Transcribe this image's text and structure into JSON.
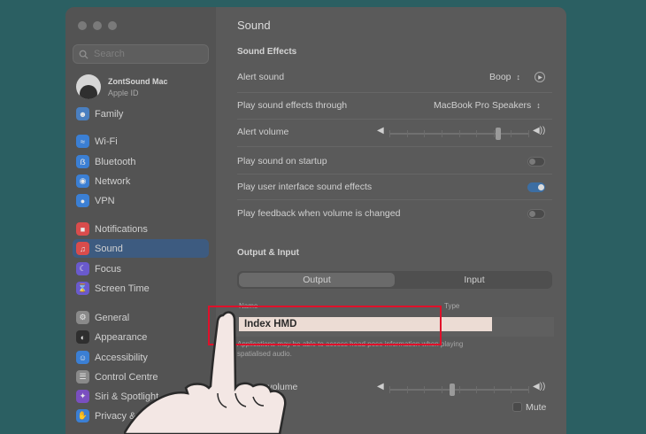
{
  "sidebar": {
    "search_placeholder": "Search",
    "account": {
      "name": "ZontSound Mac",
      "subtitle": "Apple ID"
    },
    "items": [
      {
        "label": "Family",
        "icon": "family-icon",
        "color": "#4a7fc0"
      },
      {
        "label": "Wi-Fi",
        "icon": "wifi-icon",
        "color": "#3b7fd4"
      },
      {
        "label": "Bluetooth",
        "icon": "bluetooth-icon",
        "color": "#3b7fd4"
      },
      {
        "label": "Network",
        "icon": "network-icon",
        "color": "#3b7fd4"
      },
      {
        "label": "VPN",
        "icon": "vpn-icon",
        "color": "#3b7fd4"
      },
      {
        "label": "Notifications",
        "icon": "notifications-icon",
        "color": "#d94c4c"
      },
      {
        "label": "Sound",
        "icon": "sound-icon",
        "color": "#d94c4c"
      },
      {
        "label": "Focus",
        "icon": "focus-icon",
        "color": "#6a5acd"
      },
      {
        "label": "Screen Time",
        "icon": "screen-time-icon",
        "color": "#6a5acd"
      },
      {
        "label": "General",
        "icon": "general-icon",
        "color": "#8a8a8a"
      },
      {
        "label": "Appearance",
        "icon": "appearance-icon",
        "color": "#2f2f2f"
      },
      {
        "label": "Accessibility",
        "icon": "accessibility-icon",
        "color": "#3b7fd4"
      },
      {
        "label": "Control Centre",
        "icon": "control-centre-icon",
        "color": "#8a8a8a"
      },
      {
        "label": "Siri & Spotlight",
        "icon": "siri-icon",
        "color": "#7a4fc0"
      },
      {
        "label": "Privacy & Se",
        "icon": "privacy-icon",
        "color": "#3b7fd4"
      }
    ]
  },
  "content": {
    "title": "Sound",
    "sound_effects": {
      "header": "Sound Effects",
      "alert_sound": {
        "label": "Alert sound",
        "value": "Boop"
      },
      "play_through": {
        "label": "Play sound effects through",
        "value": "MacBook Pro Speakers"
      },
      "alert_volume": {
        "label": "Alert volume",
        "level": 0.78
      },
      "startup": {
        "label": "Play sound on startup",
        "on": false
      },
      "ui_effects": {
        "label": "Play user interface sound effects",
        "on": true
      },
      "feedback": {
        "label": "Play feedback when volume is changed",
        "on": false
      }
    },
    "output_input": {
      "header": "Output & Input",
      "tabs": [
        "Output",
        "Input"
      ],
      "columns": {
        "name": "Name",
        "type": "Type"
      },
      "selected_device": "Index HMD",
      "note": "Applications may be able to access head pose information when playing spatialised audio.",
      "output_volume": {
        "label": "Output volume",
        "level": 0.45
      },
      "mute_label": "Mute"
    }
  },
  "colors": {
    "highlight": "#e0102a",
    "accent": "#3c6ea3"
  }
}
